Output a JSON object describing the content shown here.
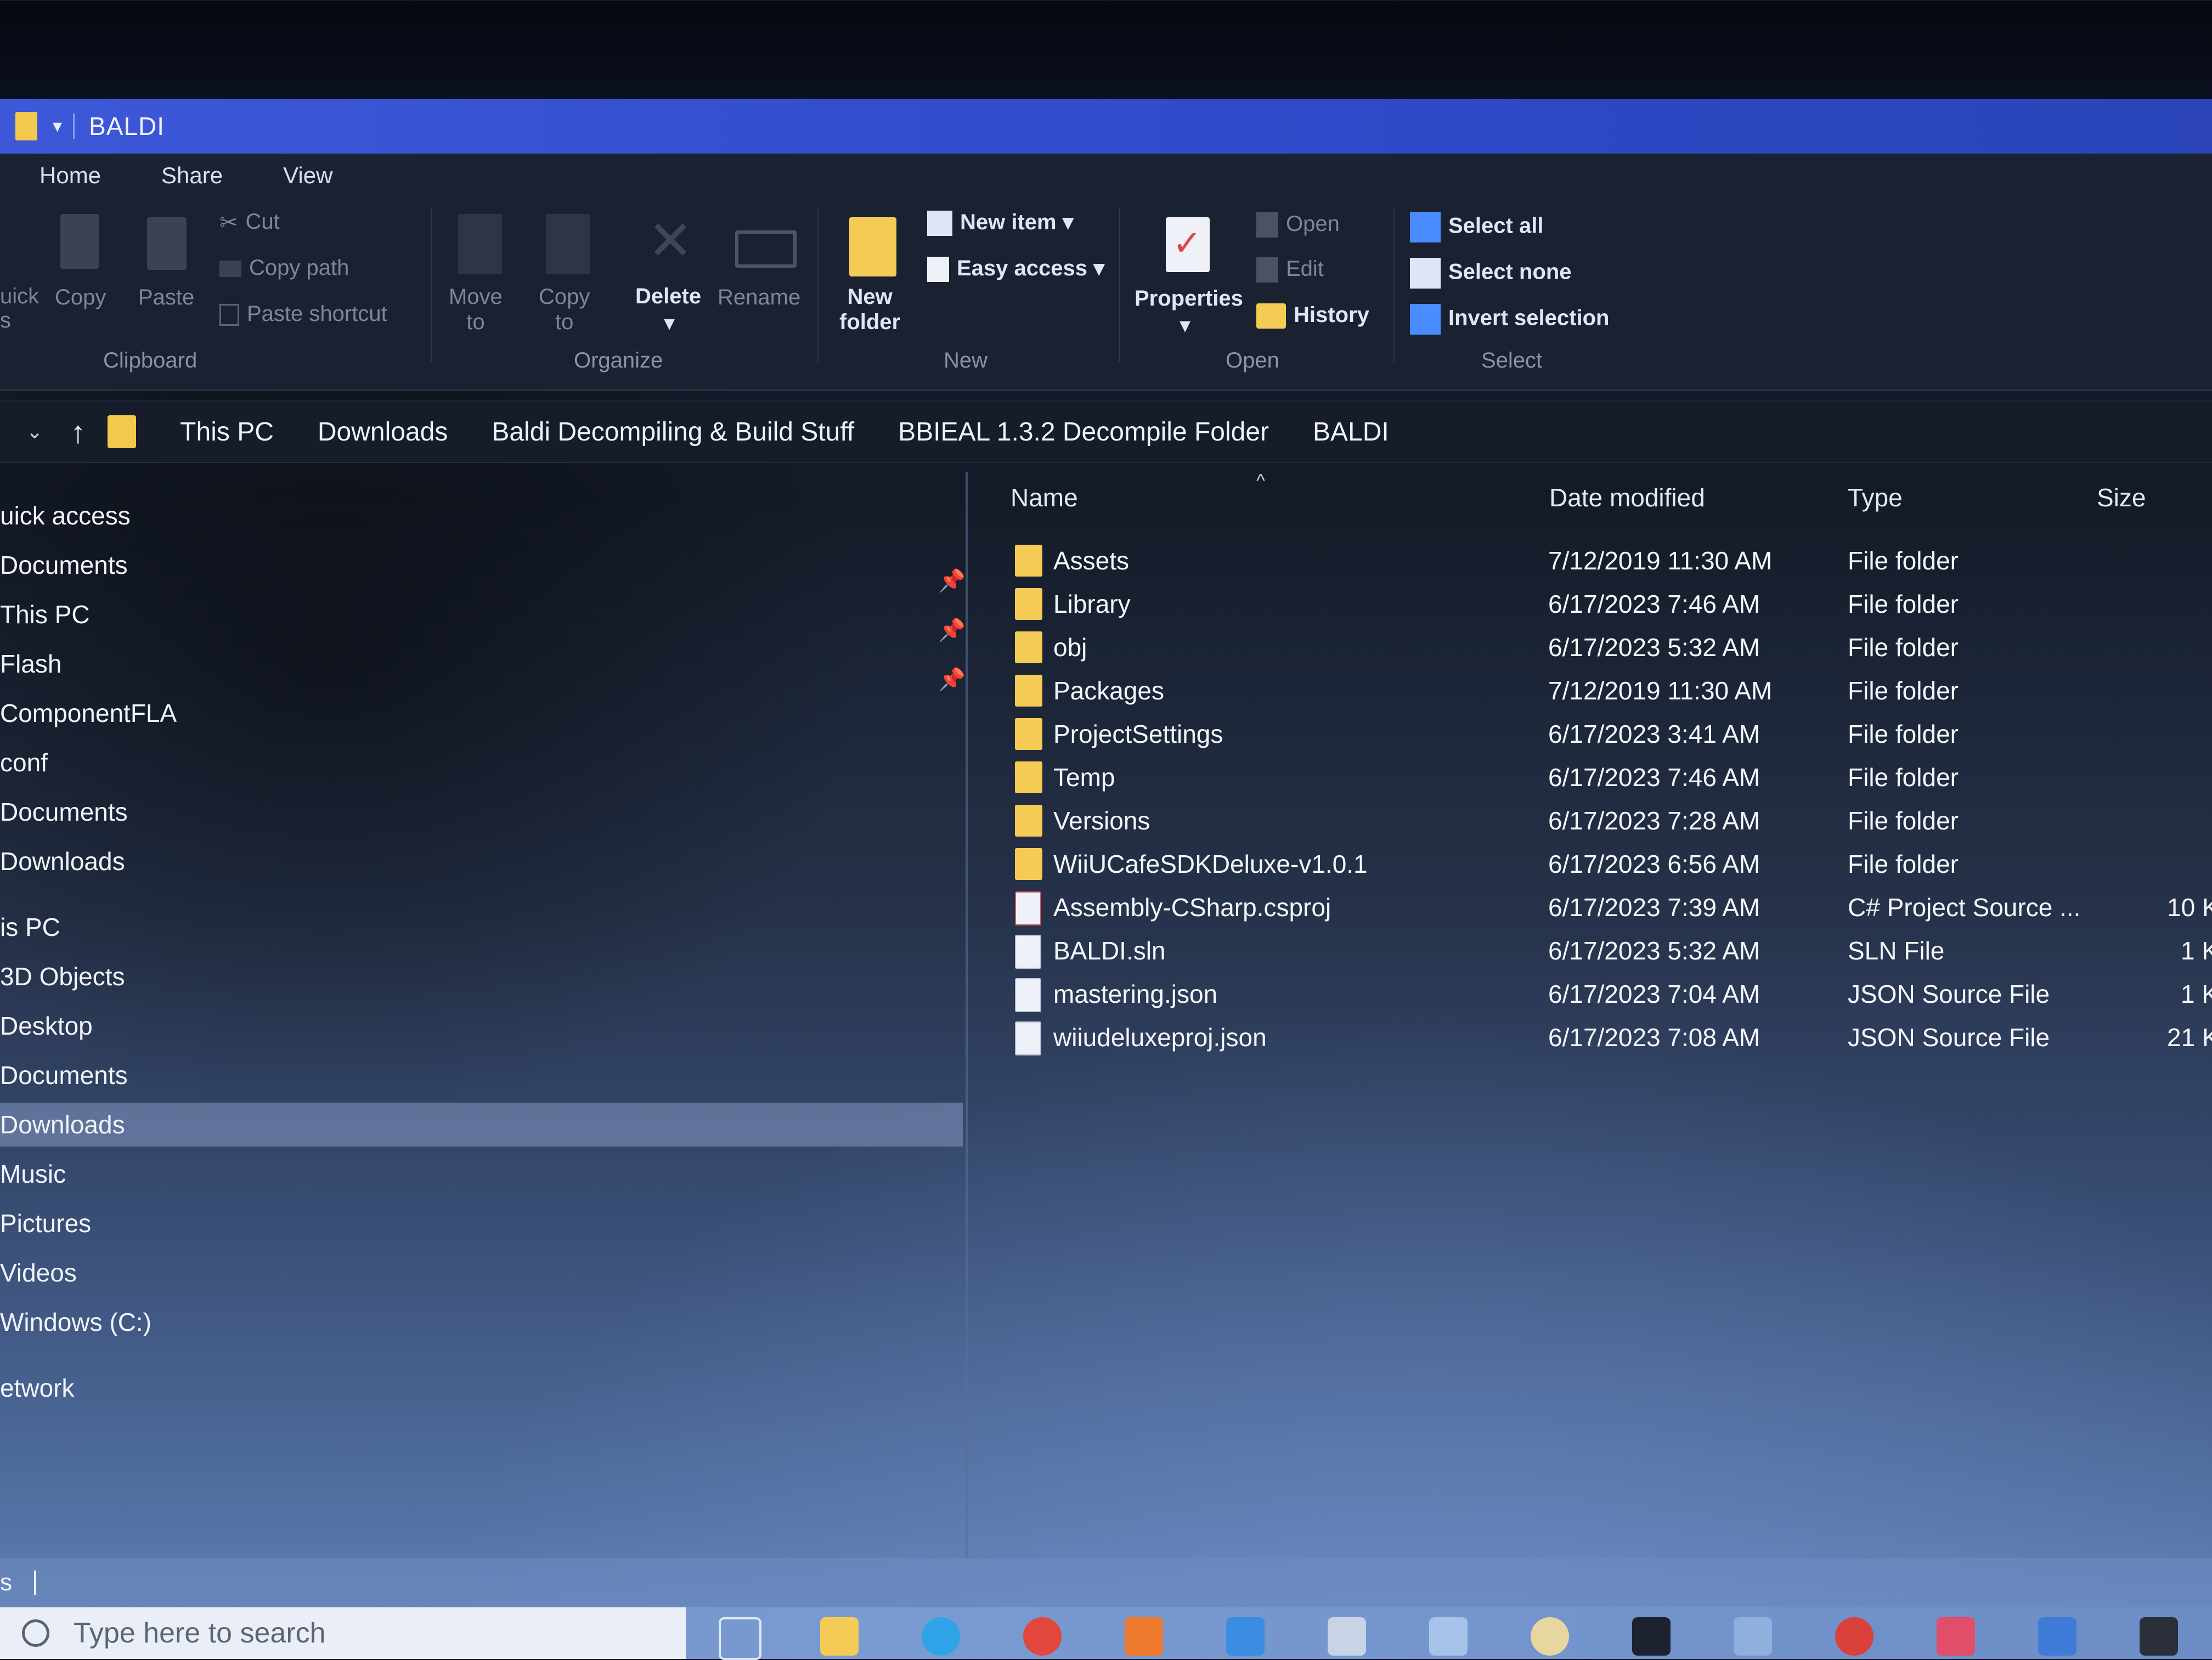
{
  "window": {
    "title": "BALDI"
  },
  "menu": {
    "home": "Home",
    "share": "Share",
    "view": "View"
  },
  "ribbon": {
    "clipboard": {
      "quick_access": "uick\ns",
      "copy": "Copy",
      "paste": "Paste",
      "cut": "Cut",
      "copy_path": "Copy path",
      "paste_shortcut": "Paste shortcut",
      "group": "Clipboard"
    },
    "organize": {
      "move_to": "Move\nto",
      "copy_to": "Copy\nto",
      "delete": "Delete",
      "rename": "Rename",
      "group": "Organize"
    },
    "new": {
      "new_folder": "New\nfolder",
      "new_item": "New item",
      "easy_access": "Easy access",
      "group": "New"
    },
    "open": {
      "properties": "Properties",
      "open": "Open",
      "edit": "Edit",
      "history": "History",
      "group": "Open"
    },
    "select": {
      "select_all": "Select all",
      "select_none": "Select none",
      "invert_selection": "Invert selection",
      "group": "Select"
    }
  },
  "breadcrumb": [
    "This PC",
    "Downloads",
    "Baldi Decompiling & Build Stuff",
    "BBIEAL 1.3.2 Decompile Folder",
    "BALDI"
  ],
  "nav": [
    "uick access",
    "Documents",
    "This PC",
    "Flash",
    "ComponentFLA",
    "conf",
    "Documents",
    "Downloads",
    "is PC",
    "3D Objects",
    "Desktop",
    "Documents",
    "Downloads",
    "Music",
    "Pictures",
    "Videos",
    "Windows (C:)",
    "etwork"
  ],
  "nav_selected_index": 12,
  "columns": {
    "name": "Name",
    "date": "Date modified",
    "type": "Type",
    "size": "Size"
  },
  "files": [
    {
      "name": "Assets",
      "date": "7/12/2019 11:30 AM",
      "type": "File folder",
      "size": "",
      "icon": "folder-icon"
    },
    {
      "name": "Library",
      "date": "6/17/2023 7:46 AM",
      "type": "File folder",
      "size": "",
      "icon": "folder-icon"
    },
    {
      "name": "obj",
      "date": "6/17/2023 5:32 AM",
      "type": "File folder",
      "size": "",
      "icon": "folder-icon"
    },
    {
      "name": "Packages",
      "date": "7/12/2019 11:30 AM",
      "type": "File folder",
      "size": "",
      "icon": "folder-icon"
    },
    {
      "name": "ProjectSettings",
      "date": "6/17/2023 3:41 AM",
      "type": "File folder",
      "size": "",
      "icon": "folder-icon"
    },
    {
      "name": "Temp",
      "date": "6/17/2023 7:46 AM",
      "type": "File folder",
      "size": "",
      "icon": "folder-icon"
    },
    {
      "name": "Versions",
      "date": "6/17/2023 7:28 AM",
      "type": "File folder",
      "size": "",
      "icon": "folder-icon"
    },
    {
      "name": "WiiUCafeSDKDeluxe-v1.0.1",
      "date": "6/17/2023 6:56 AM",
      "type": "File folder",
      "size": "",
      "icon": "folder-icon"
    },
    {
      "name": "Assembly-CSharp.csproj",
      "date": "6/17/2023 7:39 AM",
      "type": "C# Project Source ...",
      "size": "10 K",
      "icon": "csproj-icon"
    },
    {
      "name": "BALDI.sln",
      "date": "6/17/2023 5:32 AM",
      "type": "SLN File",
      "size": "1 K",
      "icon": "file-icon"
    },
    {
      "name": "mastering.json",
      "date": "6/17/2023 7:04 AM",
      "type": "JSON Source File",
      "size": "1 K",
      "icon": "file-icon"
    },
    {
      "name": "wiiudeluxeproj.json",
      "date": "6/17/2023 7:08 AM",
      "type": "JSON Source File",
      "size": "21 K",
      "icon": "file-icon"
    }
  ],
  "status": {
    "text": "s"
  },
  "taskbar": {
    "search_placeholder": "Type here to search"
  },
  "colors": {
    "title_bar": "#3d58d8",
    "ribbon_bg": "#1a2130",
    "folder": "#f4cc55",
    "selection": "#96aad7",
    "accent_blue": "#4a8cff"
  }
}
